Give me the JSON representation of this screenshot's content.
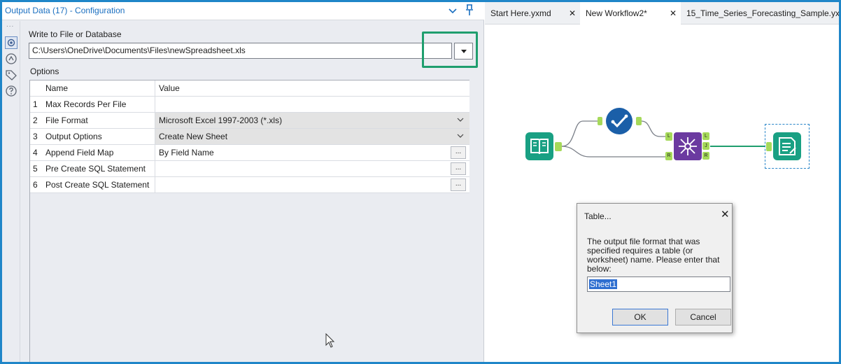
{
  "config": {
    "title": "Output Data (17) - Configuration",
    "rail_dots": "...",
    "write_label": "Write to File or Database",
    "path_value": "C:\\Users\\OneDrive\\Documents\\Files\\newSpreadsheet.xls",
    "options_label": "Options",
    "grid": {
      "header": {
        "num": "",
        "name": "Name",
        "value": "Value"
      },
      "rows": [
        {
          "num": "1",
          "name": "Max Records Per File",
          "value": ""
        },
        {
          "num": "2",
          "name": "File Format",
          "value": "Microsoft Excel 1997-2003 (*.xls)"
        },
        {
          "num": "3",
          "name": "Output Options",
          "value": "Create New Sheet"
        },
        {
          "num": "4",
          "name": "Append Field Map",
          "value": "By Field Name"
        },
        {
          "num": "5",
          "name": "Pre Create SQL Statement",
          "value": ""
        },
        {
          "num": "6",
          "name": "Post Create SQL Statement",
          "value": ""
        }
      ],
      "ellipsis": "..."
    }
  },
  "tabs": [
    {
      "label": "Start Here.yxmd",
      "close": "✕"
    },
    {
      "label": "New Workflow2*",
      "close": "✕"
    },
    {
      "label": "15_Time_Series_Forecasting_Sample.yx",
      "close": ""
    }
  ],
  "dialog": {
    "title": "Table...",
    "close": "✕",
    "message": "The output file format that was specified requires a table (or worksheet) name. Please enter that below:",
    "input_value": "Sheet1",
    "ok": "OK",
    "cancel": "Cancel"
  },
  "anchors": {
    "L1": "L",
    "R1": "R",
    "L2": "L",
    "J": "J",
    "R2": "R"
  },
  "colors": {
    "accent": "#1f86c8",
    "highlight": "#1f9e6e",
    "input_tool": "#19a083",
    "join_tool": "#6b3aa0",
    "check_tool": "#1b5fa8",
    "anchor": "#a6d95a"
  }
}
